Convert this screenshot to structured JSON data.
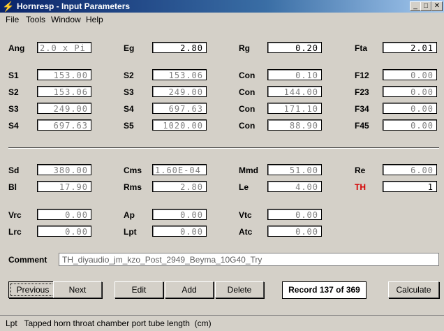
{
  "window": {
    "title": "Hornresp - Input Parameters",
    "icon": "lightning-icon"
  },
  "menu": [
    "File",
    "Tools",
    "Window",
    "Help"
  ],
  "rows": [
    {
      "labels": [
        "Ang",
        "Eg",
        "Rg",
        "Fta"
      ],
      "values": [
        "2.0 x Pi",
        "2.80",
        "0.20",
        "2.01"
      ]
    },
    {
      "labels": [
        "S1",
        "S2",
        "Con",
        "F12"
      ],
      "values": [
        "153.00",
        "153.06",
        "0.10",
        "0.00"
      ]
    },
    {
      "labels": [
        "S2",
        "S3",
        "Con",
        "F23"
      ],
      "values": [
        "153.06",
        "249.00",
        "144.00",
        "0.00"
      ]
    },
    {
      "labels": [
        "S3",
        "S4",
        "Con",
        "F34"
      ],
      "values": [
        "249.00",
        "697.63",
        "171.10",
        "0.00"
      ]
    },
    {
      "labels": [
        "S4",
        "S5",
        "Con",
        "F45"
      ],
      "values": [
        "697.63",
        "1020.00",
        "88.90",
        "0.00"
      ]
    },
    {
      "labels": [
        "Sd",
        "Cms",
        "Mmd",
        "Re"
      ],
      "values": [
        "380.00",
        "1.60E-04",
        "51.00",
        "6.00"
      ]
    },
    {
      "labels": [
        "Bl",
        "Rms",
        "Le",
        "TH"
      ],
      "values": [
        "17.90",
        "2.80",
        "4.00",
        "1"
      ]
    },
    {
      "labels": [
        "Vrc",
        "Ap",
        "Vtc"
      ],
      "values": [
        "0.00",
        "0.00",
        "0.00"
      ]
    },
    {
      "labels": [
        "Lrc",
        "Lpt",
        "Atc"
      ],
      "values": [
        "0.00",
        "0.00",
        "0.00"
      ]
    }
  ],
  "comment": {
    "label": "Comment",
    "value": "TH_diyaudio_jm_kzo_Post_2949_Beyma_10G40_Try"
  },
  "buttons": {
    "previous": "Previous",
    "next": "Next",
    "edit": "Edit",
    "add": "Add",
    "delete": "Delete",
    "calculate": "Calculate"
  },
  "record": "Record 137 of 369",
  "status": "Lpt   Tapped horn throat chamber port tube length  (cm)",
  "colors": {
    "th_label": "#d40000",
    "title_gradient_start": "#0a246a"
  }
}
